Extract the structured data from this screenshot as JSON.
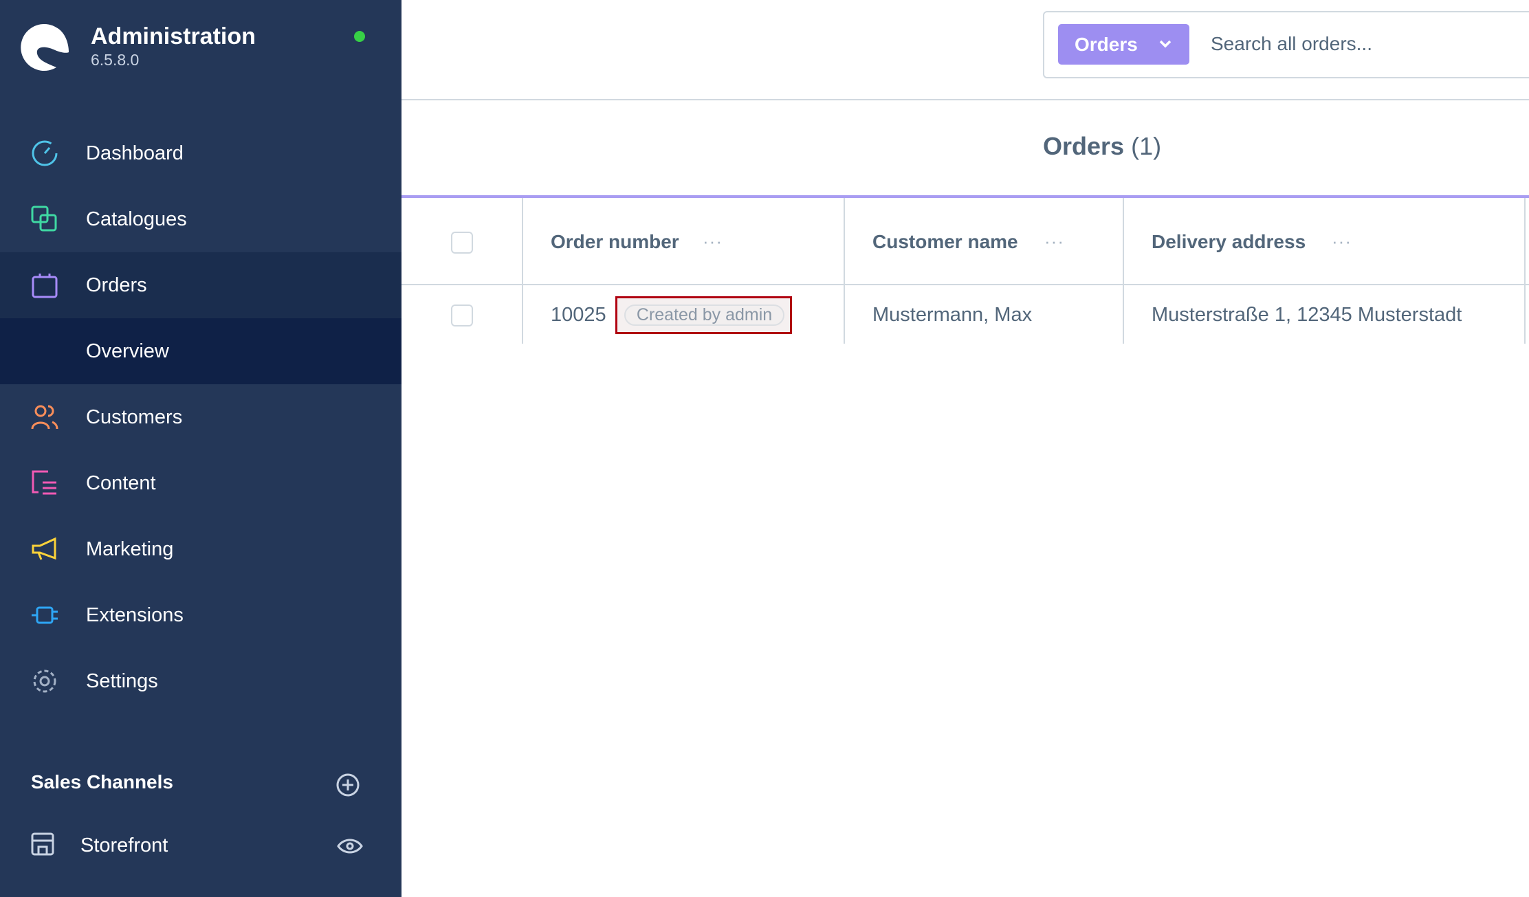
{
  "app": {
    "title": "Administration",
    "version": "6.5.8.0",
    "status_color": "#37d046"
  },
  "sidebar": {
    "items": [
      {
        "label": "Dashboard",
        "icon": "dashboard-icon",
        "color": "#4fc3e8"
      },
      {
        "label": "Catalogues",
        "icon": "catalogue-icon",
        "color": "#3fd9a3"
      },
      {
        "label": "Orders",
        "icon": "shopping-bag-icon",
        "color": "#a78bfa"
      },
      {
        "label": "Overview"
      },
      {
        "label": "Customers",
        "icon": "customers-icon",
        "color": "#f98e5a"
      },
      {
        "label": "Content",
        "icon": "content-icon",
        "color": "#f05ab3"
      },
      {
        "label": "Marketing",
        "icon": "megaphone-icon",
        "color": "#fbd23a"
      },
      {
        "label": "Extensions",
        "icon": "plug-icon",
        "color": "#2ea6f5"
      },
      {
        "label": "Settings",
        "icon": "gear-icon",
        "color": "#a3b1c6"
      }
    ],
    "sales_channels": {
      "title": "Sales Channels",
      "items": [
        {
          "label": "Storefront"
        }
      ]
    }
  },
  "search": {
    "type_label": "Orders",
    "placeholder": "Search all orders..."
  },
  "page": {
    "title": "Orders",
    "count": "(1)"
  },
  "table": {
    "columns": [
      "Order number",
      "Customer name",
      "Delivery address"
    ],
    "rows": [
      {
        "order_number": "10025",
        "badge": "Created by admin",
        "customer": "Mustermann, Max",
        "address": "Musterstraße 1, 12345 Musterstadt"
      }
    ]
  }
}
